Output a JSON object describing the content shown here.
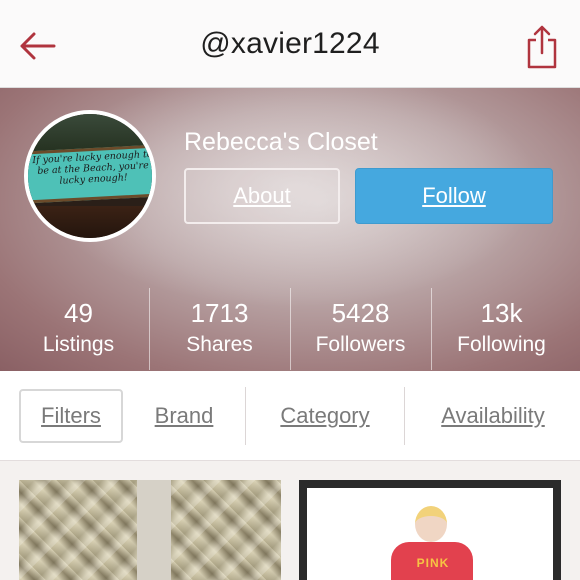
{
  "header": {
    "username": "@xavier1224",
    "back_icon": "back-arrow-icon",
    "share_icon": "share-icon",
    "accent_color": "#b0343e"
  },
  "profile": {
    "display_name": "Rebecca's Closet",
    "avatar_caption": "If you're lucky enough to be at the Beach, you're lucky enough!",
    "about_label": "About",
    "follow_label": "Follow",
    "follow_color": "#45a8df"
  },
  "stats": [
    {
      "value": "49",
      "label": "Listings"
    },
    {
      "value": "1713",
      "label": "Shares"
    },
    {
      "value": "5428",
      "label": "Followers"
    },
    {
      "value": "13k",
      "label": "Following"
    }
  ],
  "filters": {
    "filters_label": "Filters",
    "brand_label": "Brand",
    "category_label": "Category",
    "availability_label": "Availability"
  },
  "listings": {
    "print_text": "PINK"
  }
}
